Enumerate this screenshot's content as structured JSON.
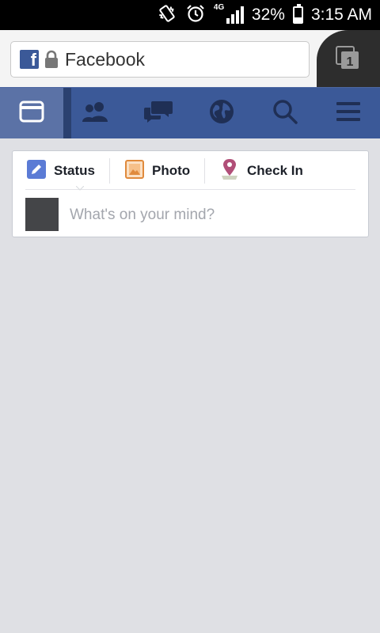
{
  "status_bar": {
    "network_label": "4G",
    "battery_percent_text": "32%",
    "battery_level": 0.32,
    "time": "3:15 AM",
    "icons": [
      "vibrate-icon",
      "alarm-icon",
      "signal-icon",
      "battery-icon"
    ]
  },
  "browser": {
    "url_text": "Facebook",
    "tab_count": "1",
    "colors": {
      "tabs_area": "#2d2d2d",
      "bar": "#f4f4f4"
    }
  },
  "fb_nav": {
    "items": [
      {
        "name": "news-feed",
        "icon": "news-feed-icon",
        "active": true
      },
      {
        "name": "friend-requests",
        "icon": "friends-icon",
        "active": false
      },
      {
        "name": "messages",
        "icon": "messages-icon",
        "active": false
      },
      {
        "name": "notifications",
        "icon": "globe-icon",
        "active": false
      },
      {
        "name": "search",
        "icon": "search-icon",
        "active": false
      },
      {
        "name": "menu",
        "icon": "menu-icon",
        "active": false
      }
    ],
    "colors": {
      "bar": "#3b5998",
      "active": "#5b72a6"
    }
  },
  "composer": {
    "status_label": "Status",
    "photo_label": "Photo",
    "checkin_label": "Check In",
    "placeholder": "What's on your mind?"
  }
}
